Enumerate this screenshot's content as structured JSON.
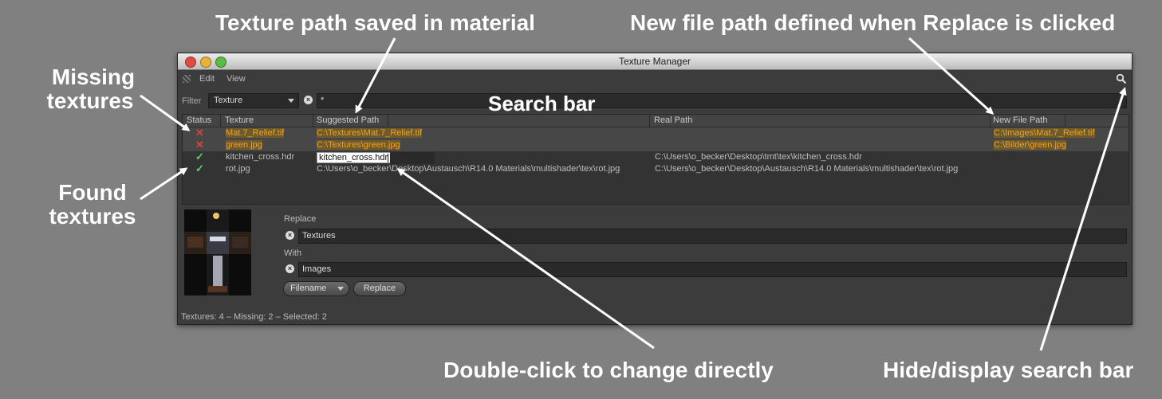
{
  "annotations": {
    "texture_path_saved": "Texture path saved in material",
    "new_file_path_defined": "New file path defined when Replace is clicked",
    "missing_textures_line1": "Missing",
    "missing_textures_line2": "textures",
    "search_bar": "Search bar",
    "found_textures_line1": "Found",
    "found_textures_line2": "textures",
    "double_click": "Double-click to change directly",
    "hide_display_search": "Hide/display search bar"
  },
  "window": {
    "title": "Texture Manager"
  },
  "menu": {
    "edit": "Edit",
    "view": "View"
  },
  "filter": {
    "label": "Filter",
    "selected": "Texture",
    "search_value": "*"
  },
  "table": {
    "headers": {
      "status": "Status",
      "texture": "Texture",
      "suggested_path": "Suggested Path",
      "real_path": "Real Path",
      "new_file_path": "New File Path"
    },
    "rows": [
      {
        "status": "missing",
        "texture": "Mat.7_Relief.tif",
        "suggested_path": "C:\\Textures\\Mat.7_Relief.tif",
        "real_path": "",
        "new_file_path": "C:\\Images\\Mat.7_Relief.tif"
      },
      {
        "status": "missing",
        "texture": "green.jpg",
        "suggested_path": "C:\\Textures\\green.jpg",
        "real_path": "",
        "new_file_path": "C:\\Bilder\\green.jpg"
      },
      {
        "status": "found",
        "texture": "kitchen_cross.hdr",
        "suggested_path": "kitchen_cross.hdr",
        "real_path": "C:\\Users\\o_becker\\Desktop\\tmt\\tex\\kitchen_cross.hdr",
        "new_file_path": ""
      },
      {
        "status": "found",
        "texture": "rot.jpg",
        "suggested_path": "C:\\Users\\o_becker\\Desktop\\Austausch\\R14.0 Materials\\multishader\\tex\\rot.jpg",
        "real_path": "C:\\Users\\o_becker\\Desktop\\Austausch\\R14.0 Materials\\multishader\\tex\\rot.jpg",
        "new_file_path": ""
      }
    ]
  },
  "replace": {
    "label": "Replace",
    "value": "Textures"
  },
  "with": {
    "label": "With",
    "value": "Images"
  },
  "mode": {
    "selected": "Filename"
  },
  "replace_button": "Replace",
  "status_bar": "Textures: 4 – Missing: 2 – Selected: 2",
  "colors": {
    "missing": "#f0a02a",
    "found": "#5fd36a",
    "error": "#e0413a"
  },
  "icons": {
    "missing": "cross-icon",
    "found": "checkmark-icon",
    "search": "magnifier-icon",
    "clear": "clear-circle-icon"
  }
}
